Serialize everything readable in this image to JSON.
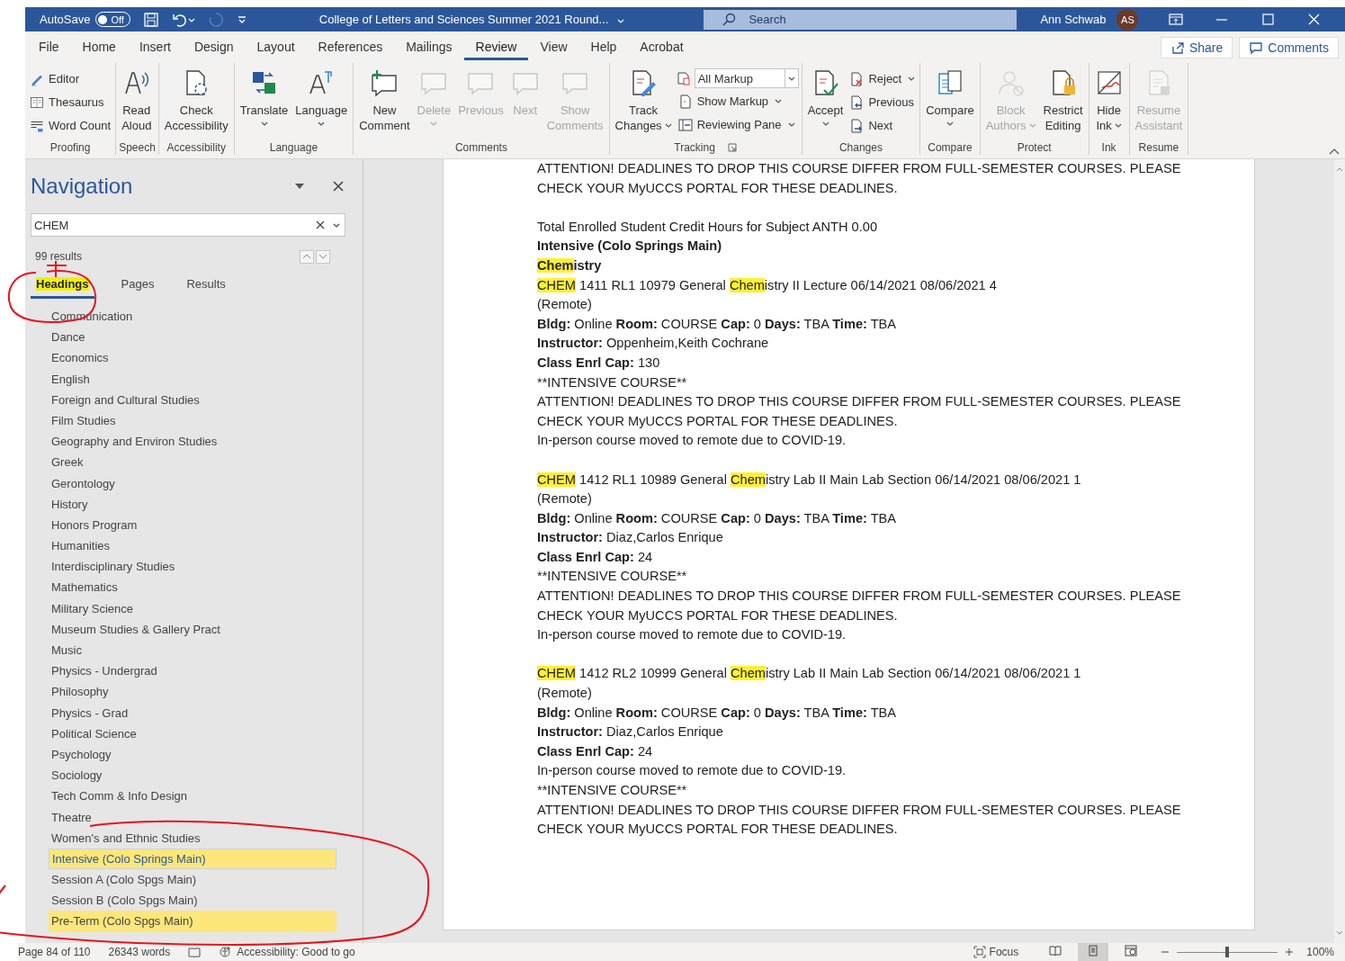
{
  "title_bar": {
    "autosave": {
      "label": "AutoSave",
      "on": false,
      "state_label": "Off"
    },
    "title": "College of Letters and Sciences Summer 2021 Round...",
    "search": {
      "placeholder": "Search"
    },
    "user": {
      "name": "Ann Schwab",
      "initials": "AS"
    }
  },
  "menu_tabs": [
    {
      "label": "File",
      "selected": false
    },
    {
      "label": "Home",
      "selected": false
    },
    {
      "label": "Insert",
      "selected": false
    },
    {
      "label": "Design",
      "selected": false
    },
    {
      "label": "Layout",
      "selected": false
    },
    {
      "label": "References",
      "selected": false
    },
    {
      "label": "Mailings",
      "selected": false
    },
    {
      "label": "Review",
      "selected": true
    },
    {
      "label": "View",
      "selected": false
    },
    {
      "label": "Help",
      "selected": false
    },
    {
      "label": "Acrobat",
      "selected": false
    }
  ],
  "menu_buttons": [
    {
      "label": "Share"
    },
    {
      "label": "Comments"
    }
  ],
  "ribbon": [
    {
      "label": "Proofing",
      "launcher": false,
      "items": [
        {
          "kind": "stack",
          "items": [
            {
              "kind": "small",
              "label": "Editor",
              "disabled": false,
              "dropdown": false
            },
            {
              "kind": "small",
              "label": "Thesaurus",
              "disabled": false,
              "dropdown": false
            },
            {
              "kind": "small",
              "label": "Word Count",
              "disabled": false,
              "dropdown": false
            }
          ]
        }
      ]
    },
    {
      "label": "Speech",
      "launcher": false,
      "items": [
        {
          "kind": "large",
          "label": "Read\nAloud",
          "disabled": false,
          "dropdown": false
        }
      ]
    },
    {
      "label": "Accessibility",
      "launcher": false,
      "items": [
        {
          "kind": "large",
          "label": "Check\nAccessibility",
          "disabled": false,
          "dropdown": false
        }
      ]
    },
    {
      "label": "Language",
      "launcher": false,
      "items": [
        {
          "kind": "large",
          "label": "Translate",
          "disabled": false,
          "dropdown": true
        },
        {
          "kind": "large",
          "label": "Language",
          "disabled": false,
          "dropdown": true
        }
      ]
    },
    {
      "label": "Comments",
      "launcher": false,
      "items": [
        {
          "kind": "large",
          "label": "New\nComment",
          "disabled": false,
          "dropdown": false
        },
        {
          "kind": "large",
          "label": "Delete",
          "disabled": true,
          "dropdown": true
        },
        {
          "kind": "large",
          "label": "Previous",
          "disabled": true,
          "dropdown": false
        },
        {
          "kind": "large",
          "label": "Next",
          "disabled": true,
          "dropdown": false
        },
        {
          "kind": "large",
          "label": "Show\nComments",
          "disabled": true,
          "dropdown": false
        }
      ]
    },
    {
      "label": "Tracking",
      "launcher": true,
      "items": [
        {
          "kind": "large",
          "label": "Track\nChanges",
          "disabled": false,
          "dropdown": true
        },
        {
          "kind": "stack",
          "items": [
            {
              "kind": "select",
              "label": "All Markup",
              "disabled": false,
              "dropdown": true
            },
            {
              "kind": "small",
              "label": "Show Markup",
              "disabled": false,
              "dropdown": true
            },
            {
              "kind": "small",
              "label": "Reviewing Pane",
              "disabled": false,
              "dropdown": true
            }
          ]
        }
      ]
    },
    {
      "label": "Changes",
      "launcher": false,
      "items": [
        {
          "kind": "large",
          "label": "Accept",
          "disabled": false,
          "dropdown": true
        },
        {
          "kind": "stack",
          "items": [
            {
              "kind": "small",
              "label": "Reject",
              "disabled": false,
              "dropdown": true
            },
            {
              "kind": "small",
              "label": "Previous",
              "disabled": false,
              "dropdown": false
            },
            {
              "kind": "small",
              "label": "Next",
              "disabled": false,
              "dropdown": false
            }
          ]
        }
      ]
    },
    {
      "label": "Compare",
      "launcher": false,
      "items": [
        {
          "kind": "large",
          "label": "Compare",
          "disabled": false,
          "dropdown": true
        }
      ]
    },
    {
      "label": "Protect",
      "launcher": false,
      "items": [
        {
          "kind": "large",
          "label": "Block\nAuthors",
          "disabled": true,
          "dropdown": true
        },
        {
          "kind": "large",
          "label": "Restrict\nEditing",
          "disabled": false,
          "dropdown": false
        }
      ]
    },
    {
      "label": "Ink",
      "launcher": false,
      "items": [
        {
          "kind": "large",
          "label": "Hide\nInk",
          "disabled": false,
          "dropdown": true
        }
      ]
    },
    {
      "label": "Resume",
      "launcher": false,
      "items": [
        {
          "kind": "large",
          "label": "Resume\nAssistant",
          "disabled": true,
          "dropdown": false
        }
      ]
    }
  ],
  "navigation": {
    "title": "Navigation",
    "search": {
      "value": "CHEM"
    },
    "result_count": "99 results",
    "tabs": [
      {
        "label": "Headings",
        "selected": true
      },
      {
        "label": "Pages",
        "selected": false
      },
      {
        "label": "Results",
        "selected": false
      }
    ],
    "headings": [
      {
        "label": "Communication",
        "highlight": false,
        "selected": false
      },
      {
        "label": "Dance",
        "highlight": false,
        "selected": false
      },
      {
        "label": "Economics",
        "highlight": false,
        "selected": false
      },
      {
        "label": "English",
        "highlight": false,
        "selected": false
      },
      {
        "label": "Foreign and Cultural Studies",
        "highlight": false,
        "selected": false
      },
      {
        "label": "Film Studies",
        "highlight": false,
        "selected": false
      },
      {
        "label": "Geography and Environ Studies",
        "highlight": false,
        "selected": false
      },
      {
        "label": "Greek",
        "highlight": false,
        "selected": false
      },
      {
        "label": "Gerontology",
        "highlight": false,
        "selected": false
      },
      {
        "label": "History",
        "highlight": false,
        "selected": false
      },
      {
        "label": "Honors Program",
        "highlight": false,
        "selected": false
      },
      {
        "label": "Humanities",
        "highlight": false,
        "selected": false
      },
      {
        "label": "Interdisciplinary Studies",
        "highlight": false,
        "selected": false
      },
      {
        "label": "Mathematics",
        "highlight": false,
        "selected": false
      },
      {
        "label": "Military Science",
        "highlight": false,
        "selected": false
      },
      {
        "label": "Museum Studies & Gallery Pract",
        "highlight": false,
        "selected": false
      },
      {
        "label": "Music",
        "highlight": false,
        "selected": false
      },
      {
        "label": "Physics - Undergrad",
        "highlight": false,
        "selected": false
      },
      {
        "label": "Philosophy",
        "highlight": false,
        "selected": false
      },
      {
        "label": "Physics - Grad",
        "highlight": false,
        "selected": false
      },
      {
        "label": "Political Science",
        "highlight": false,
        "selected": false
      },
      {
        "label": "Psychology",
        "highlight": false,
        "selected": false
      },
      {
        "label": "Sociology",
        "highlight": false,
        "selected": false
      },
      {
        "label": "Tech Comm & Info Design",
        "highlight": false,
        "selected": false
      },
      {
        "label": "Theatre",
        "highlight": false,
        "selected": false
      },
      {
        "label": "Women's and Ethnic Studies",
        "highlight": false,
        "selected": false
      },
      {
        "label": "Intensive (Colo Springs Main)",
        "highlight": true,
        "selected": true
      },
      {
        "label": "Session A (Colo Spgs Main)",
        "highlight": false,
        "selected": false
      },
      {
        "label": "Session B (Colo Spgs Main)",
        "highlight": false,
        "selected": false
      },
      {
        "label": "Pre-Term (Colo Spgs Main)",
        "highlight": true,
        "selected": false
      }
    ]
  },
  "document": {
    "blocks": [
      {
        "lines": [
          {
            "kind": "plain",
            "text": "ATTENTION! DEADLINES TO DROP THIS COURSE DIFFER FROM FULL-SEMESTER COURSES. PLEASE"
          },
          {
            "kind": "plain",
            "text": "CHECK YOUR MyUCCS PORTAL FOR THESE DEADLINES."
          }
        ]
      },
      {
        "lines": [
          {
            "kind": "plain",
            "text": "Total Enrolled Student Credit Hours for Subject ANTH 0.00"
          },
          {
            "kind": "heading",
            "text": "Intensive (Colo Springs Main)"
          },
          {
            "kind": "found-heading",
            "segments": [
              {
                "text": "Chem",
                "highlight": true
              },
              {
                "text": "istry",
                "highlight": false
              }
            ]
          },
          {
            "kind": "found",
            "segments": [
              {
                "text": "CHEM",
                "highlight": true
              },
              {
                "text": " 1411 RL1 10979 General ",
                "highlight": false
              },
              {
                "text": "Chem",
                "highlight": true
              },
              {
                "text": "istry II Lecture 06/14/2021 08/06/2021 4",
                "highlight": false
              }
            ]
          },
          {
            "kind": "plain",
            "text": "(Remote)"
          },
          {
            "kind": "plain",
            "text": "**Bldg:** Online **Room:** COURSE **Cap:** 0 **Days:** TBA **Time:** TBA"
          },
          {
            "kind": "plain",
            "text": "**Instructor:** Oppenheim,Keith Cochrane"
          },
          {
            "kind": "plain",
            "text": "**Class Enrl Cap:** 130"
          },
          {
            "kind": "literal",
            "text": "**INTENSIVE COURSE**"
          },
          {
            "kind": "plain",
            "text": "ATTENTION! DEADLINES TO DROP THIS COURSE DIFFER FROM FULL-SEMESTER COURSES. PLEASE"
          },
          {
            "kind": "plain",
            "text": "CHECK YOUR MyUCCS PORTAL FOR THESE DEADLINES."
          },
          {
            "kind": "plain",
            "text": "In-person course moved to remote due to COVID-19."
          }
        ]
      },
      {
        "lines": [
          {
            "kind": "found",
            "segments": [
              {
                "text": "CHEM",
                "highlight": true
              },
              {
                "text": " 1412 RL1 10989 General ",
                "highlight": false
              },
              {
                "text": "Chem",
                "highlight": true
              },
              {
                "text": "istry Lab II Main Lab Section 06/14/2021 08/06/2021 1",
                "highlight": false
              }
            ]
          },
          {
            "kind": "plain",
            "text": "(Remote)"
          },
          {
            "kind": "plain",
            "text": "**Bldg:** Online **Room:** COURSE **Cap:** 0 **Days:** TBA **Time:** TBA"
          },
          {
            "kind": "plain",
            "text": "**Instructor:** Diaz,Carlos Enrique"
          },
          {
            "kind": "plain",
            "text": "**Class Enrl Cap:** 24"
          },
          {
            "kind": "literal",
            "text": "**INTENSIVE COURSE**"
          },
          {
            "kind": "plain",
            "text": "ATTENTION! DEADLINES TO DROP THIS COURSE DIFFER FROM FULL-SEMESTER COURSES. PLEASE"
          },
          {
            "kind": "plain",
            "text": "CHECK YOUR MyUCCS PORTAL FOR THESE DEADLINES."
          },
          {
            "kind": "plain",
            "text": "In-person course moved to remote due to COVID-19."
          }
        ]
      },
      {
        "lines": [
          {
            "kind": "found",
            "segments": [
              {
                "text": "CHEM",
                "highlight": true
              },
              {
                "text": " 1412 RL2 10999 General ",
                "highlight": false
              },
              {
                "text": "Chem",
                "highlight": true
              },
              {
                "text": "istry Lab II Main Lab Section 06/14/2021 08/06/2021 1",
                "highlight": false
              }
            ]
          },
          {
            "kind": "plain",
            "text": "(Remote)"
          },
          {
            "kind": "plain",
            "text": "**Bldg:** Online **Room:** COURSE **Cap:** 0 **Days:** TBA **Time:** TBA"
          },
          {
            "kind": "plain",
            "text": "**Instructor:** Diaz,Carlos Enrique"
          },
          {
            "kind": "plain",
            "text": "**Class Enrl Cap:** 24"
          },
          {
            "kind": "plain",
            "text": "In-person course moved to remote due to COVID-19."
          },
          {
            "kind": "literal",
            "text": "**INTENSIVE COURSE**"
          },
          {
            "kind": "plain",
            "text": "ATTENTION! DEADLINES TO DROP THIS COURSE DIFFER FROM FULL-SEMESTER COURSES. PLEASE"
          },
          {
            "kind": "plain",
            "text": "CHECK YOUR MyUCCS PORTAL FOR THESE DEADLINES."
          }
        ]
      }
    ]
  },
  "status_bar": {
    "page": "Page 84 of 110",
    "words": "26343 words",
    "accessibility": "Accessibility: Good to go",
    "focus": "Focus",
    "views": [
      {
        "kind": "read",
        "selected": false
      },
      {
        "kind": "print",
        "selected": true
      },
      {
        "kind": "web",
        "selected": false
      }
    ],
    "zoom": {
      "level": 0.5,
      "reading": "100%"
    }
  }
}
